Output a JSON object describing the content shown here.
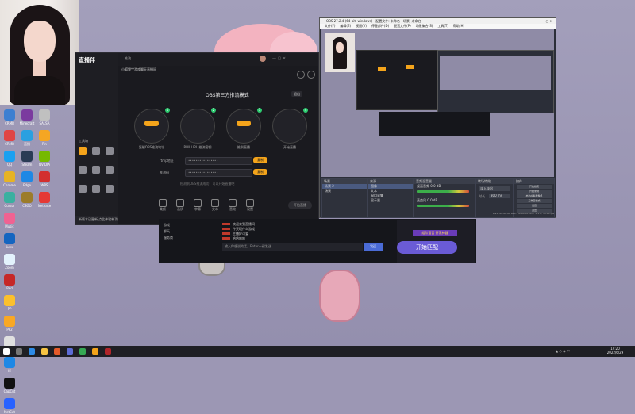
{
  "colors": {
    "accent": "#f4a41b",
    "purple_button": "#6a5bd6",
    "desktop_bg": "#9c97b4"
  },
  "desktop_icons": [
    {
      "label": "CRMB",
      "color": "#3d7fd1"
    },
    {
      "label": "Minecraft",
      "color": "#7b3b9f"
    },
    {
      "label": "SALSA",
      "color": "#c0c0c0"
    },
    {
      "label": "CRMB",
      "color": "#e04545"
    },
    {
      "label": "直播",
      "color": "#2aa0e0"
    },
    {
      "label": "Pin",
      "color": "#f5a623"
    },
    {
      "label": "QQ",
      "color": "#1aa0f0"
    },
    {
      "label": "Steam",
      "color": "#2a3b55"
    },
    {
      "label": "NVIDIA",
      "color": "#76b900"
    },
    {
      "label": "Chrome",
      "color": "#e6b325"
    },
    {
      "label": "Edge",
      "color": "#1e88e5"
    },
    {
      "label": "WPS",
      "color": "#d32f2f"
    },
    {
      "label": "Cursor",
      "color": "#3ab0a0"
    },
    {
      "label": "CSGO",
      "color": "#9c7c2a"
    },
    {
      "label": "Netease",
      "color": "#e53935"
    },
    {
      "label": "Music",
      "color": "#f06292"
    },
    {
      "label": "Kuwo",
      "color": "#1565c0"
    },
    {
      "label": "Zoom",
      "color": "#e3f2fd"
    },
    {
      "label": "Red",
      "color": "#c62828"
    },
    {
      "label": "PP",
      "color": "#fbc02d"
    },
    {
      "label": "PP2",
      "color": "#f9a825"
    },
    {
      "label": "Doc",
      "color": "#e0e0e0"
    },
    {
      "label": "IE",
      "color": "#1e88e5"
    },
    {
      "label": "CapCut",
      "color": "#111"
    },
    {
      "label": "NetCut",
      "color": "#2962ff"
    }
  ],
  "app": {
    "brand": "直播伴",
    "tab_badge": "推流",
    "user_title": "小狐狸**游戏聊天直播间",
    "panel_title": "OBS第三方推流模式",
    "exit_label": "退出",
    "steps": [
      {
        "caption": "1",
        "note": "复制OBS推流地址"
      },
      {
        "caption": "2",
        "note": "RML URL  推流密钥"
      },
      {
        "caption": "3",
        "note": "推到直播"
      },
      {
        "caption": "4",
        "note": "开始直播"
      }
    ],
    "rtmp_label": "rtmp地址",
    "key_label": "推流码",
    "rtmp_value": "••••••••••••••••",
    "key_value": "••••••••••••••••",
    "copy_label": "复制",
    "copy2_label": "复制",
    "hint": "检测到OBS推流成功，可以开始直播吧",
    "start_label": "开始直播",
    "sidebar_section": "工具箱",
    "bottom_notice": "新版本已更新 点此体验新功能",
    "bottom_items": [
      "美颜",
      "画质",
      "字幕",
      "文本",
      "音效",
      "设置"
    ]
  },
  "obs": {
    "title": "OBS 27.2.4 (64-bit, windows) - 配置文件: 未命名 - 场景: 未命名",
    "menu": [
      "文件(F)",
      "编辑(E)",
      "视图(V)",
      "停靠部件(D)",
      "配置文件(P)",
      "场景集合(S)",
      "工具(T)",
      "帮助(H)"
    ],
    "docks": {
      "scenes": "场景",
      "sources": "来源",
      "mixer": "音频混音器",
      "transitions": "转场特效",
      "controls": "控件"
    },
    "scene_items": [
      "场景 2",
      "场景"
    ],
    "source_items": [
      "图像",
      "文本",
      "窗口采集",
      "显示器"
    ],
    "mixer_items": [
      {
        "name": "桌面音频",
        "level": "0.0 dB"
      },
      {
        "name": "麦克风",
        "level": "0.0 dB"
      }
    ],
    "transition_value": "淡入淡出",
    "duration_label": "时长",
    "duration_value": "300 ms",
    "control_buttons": [
      "开始推流",
      "开始录制",
      "启动虚拟摄像机",
      "工作室模式",
      "设置",
      "退出"
    ],
    "status": "LIVE: 00:00:00   REC: 00:00:00   CPU: 3.1%, 30.00 fps"
  },
  "chat": {
    "messages": [
      "欢迎来到直播间",
      "今天玩什么游戏",
      "主播好可爱",
      "哈哈哈哈"
    ],
    "input_placeholder": "输入你想说的话，Enter一键发送",
    "send_label": "发送",
    "side_labels": [
      "游戏",
      "聊天",
      "服务商"
    ],
    "start_match": "开始匹配",
    "promo": "组队语音 开黑神器"
  },
  "taskbar": {
    "time": "19:20",
    "date": "2022/6/29"
  }
}
